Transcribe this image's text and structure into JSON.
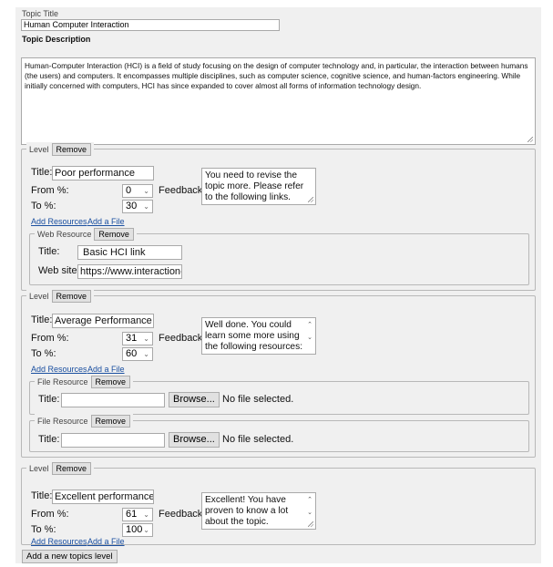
{
  "topic": {
    "title_label": "Topic Title",
    "title_value": "Human Computer Interaction",
    "description_label": "Topic Description",
    "description_text": "Human-Computer Interaction (HCI) is a field of study focusing on the design of computer technology and, in particular, the interaction between humans (the users) and computers. It encompasses multiple disciplines, such as computer science, cognitive science, and human-factors engineering. While initially concerned with computers, HCI has since expanded to cover almost all forms of information technology design."
  },
  "common": {
    "level_legend": "Level",
    "remove_label": "Remove",
    "title_label": "Title:",
    "from_label": "From %:",
    "to_label": "To %:",
    "feedback_label": "Feedback",
    "add_resources": "Add Resources",
    "add_file": "Add a File",
    "web_resource_legend": "Web Resource",
    "file_resource_legend": "File Resource",
    "web_title_label": "Title:",
    "web_site_label": "Web site",
    "browse_label": "Browse...",
    "no_file_text": "No file selected."
  },
  "levels": [
    {
      "title": "Poor performance",
      "from": "0",
      "to": "30",
      "feedback": "You need to revise the topic more. Please refer to the following links.",
      "web_resource": {
        "title": "Basic HCI link",
        "site": "https://www.interaction-d"
      }
    },
    {
      "title": "Average Performance",
      "from": "31",
      "to": "60",
      "feedback": "Well done. You could learn some more using the following resources:",
      "file_resources": [
        {
          "title": ""
        },
        {
          "title": ""
        }
      ]
    },
    {
      "title": "Excellent performance",
      "from": "61",
      "to": "100",
      "feedback": "Excellent! You have proven to know a lot about the topic."
    }
  ],
  "add_level_button": "Add a new topics level"
}
